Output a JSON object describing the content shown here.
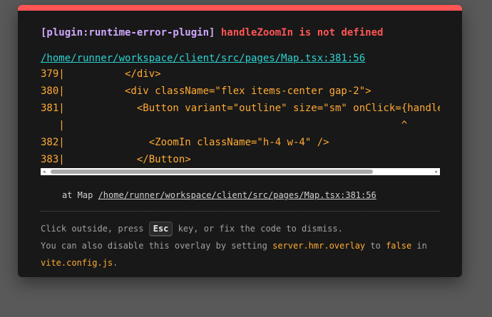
{
  "overlay": {
    "plugin_tag": "[plugin:runtime-error-plugin]",
    "message": "handleZoomIn is not defined",
    "file_link": "/home/runner/workspace/client/src/pages/Map.tsx:381:56",
    "code_frame": [
      "379|          </div>",
      "380|          <div className=\"flex items-center gap-2\">",
      "381|            <Button variant=\"outline\" size=\"sm\" onClick={handleZoomIn}>",
      "   |                                                        ^",
      "382|              <ZoomIn className=\"h-4 w-4\" />",
      "383|            </Button>"
    ],
    "scroll_left_arrow": "◂",
    "scroll_right_arrow": "▸",
    "stack_prefix": "at Map ",
    "stack_link": "/home/runner/workspace/client/src/pages/Map.tsx:381:56",
    "tip": {
      "line1_before": "Click outside, press ",
      "key": "Esc",
      "line1_after": " key, or fix the code to dismiss.",
      "line2_before": "You can also disable this overlay by setting ",
      "setting": "server.hmr.overlay",
      "line2_mid": " to ",
      "value": "false",
      "line2_after": " in",
      "config_file": "vite.config.js",
      "line3_after": "."
    }
  },
  "colors": {
    "accent_red": "#ff5555",
    "plugin_purple": "#cfa8ff",
    "link_cyan": "#2dd1d1",
    "code_orange": "#ffaa33",
    "window_bg": "#181818"
  }
}
